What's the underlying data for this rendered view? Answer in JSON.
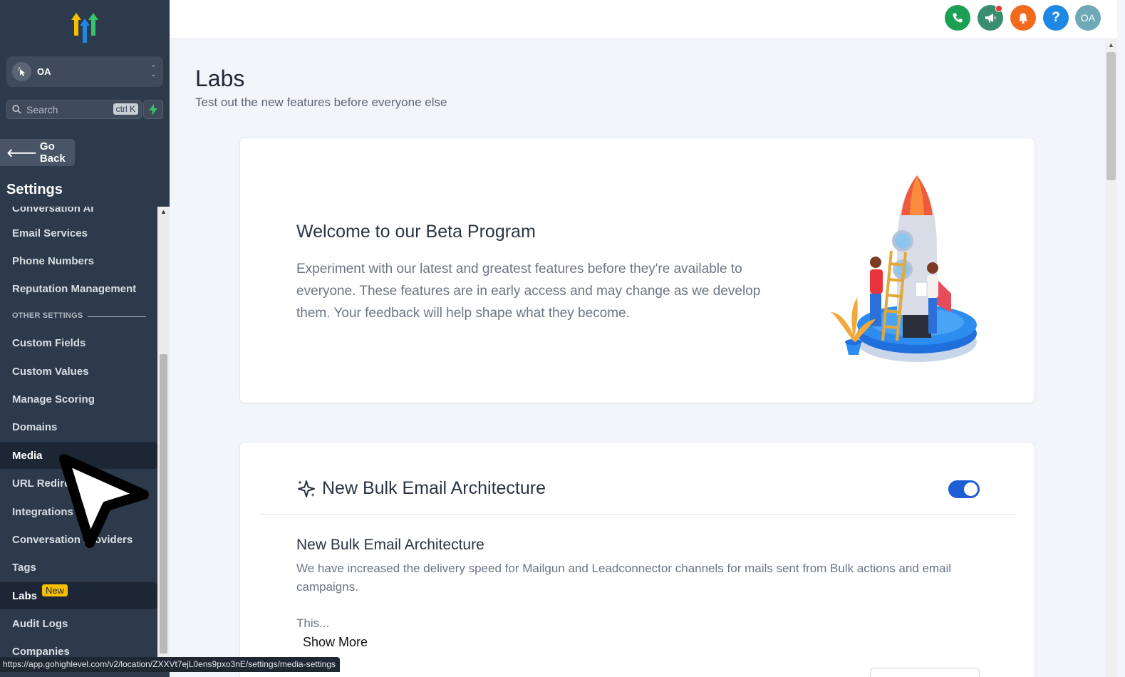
{
  "sidebar": {
    "account": {
      "initials": "OA",
      "name": "OA"
    },
    "search": {
      "placeholder": "Search",
      "shortcut": "ctrl K"
    },
    "go_back": "Go Back",
    "settings_title": "Settings",
    "items": [
      {
        "label": "Conversation AI"
      },
      {
        "label": "Email Services"
      },
      {
        "label": "Phone Numbers"
      },
      {
        "label": "Reputation Management"
      },
      {
        "label": "Custom Fields"
      },
      {
        "label": "Custom Values"
      },
      {
        "label": "Manage Scoring"
      },
      {
        "label": "Domains"
      },
      {
        "label": "Media"
      },
      {
        "label": "URL Redirects"
      },
      {
        "label": "Integrations"
      },
      {
        "label": "Conversation Providers"
      },
      {
        "label": "Tags"
      },
      {
        "label": "Labs",
        "badge": "New"
      },
      {
        "label": "Audit Logs"
      },
      {
        "label": "Companies"
      }
    ],
    "section_label": "OTHER SETTINGS"
  },
  "topbar": {
    "icons": [
      {
        "name": "phone-icon",
        "color": "#1a9f53"
      },
      {
        "name": "megaphone-icon",
        "color": "#3a8d6e"
      },
      {
        "name": "bell-icon",
        "color": "#f26b1d"
      },
      {
        "name": "help-icon",
        "color": "#1e88e5",
        "glyph": "?"
      },
      {
        "name": "user-avatar",
        "color": "#6ea9b8",
        "glyph": "OA"
      }
    ]
  },
  "main": {
    "title": "Labs",
    "subtitle": "Test out the new features before everyone else",
    "welcome": {
      "title": "Welcome to our Beta Program",
      "body": "Experiment with our latest and greatest features before they're available to everyone. These features are in early access and may change as we develop them. Your feedback will help shape what they become."
    },
    "feature": {
      "title": "New Bulk Email Architecture",
      "enabled": true,
      "subtitle": "New Bulk Email Architecture",
      "description": "We have increased the delivery speed for Mailgun and Leadconnector channels for mails sent from Bulk actions and email campaigns.",
      "truncated": "This...",
      "show_more": "Show More"
    }
  },
  "status_bar": {
    "url": "https://app.gohighlevel.com/v2/location/ZXXVt7ejL0ens9pxo3nE/settings/media-settings"
  },
  "colors": {
    "sidebar_bg": "#2d3a4b",
    "active_item_bg": "#1d2634",
    "badge": "#f6c000",
    "toggle_on": "#1d5fd6",
    "page_bg": "#f2f5f9"
  }
}
